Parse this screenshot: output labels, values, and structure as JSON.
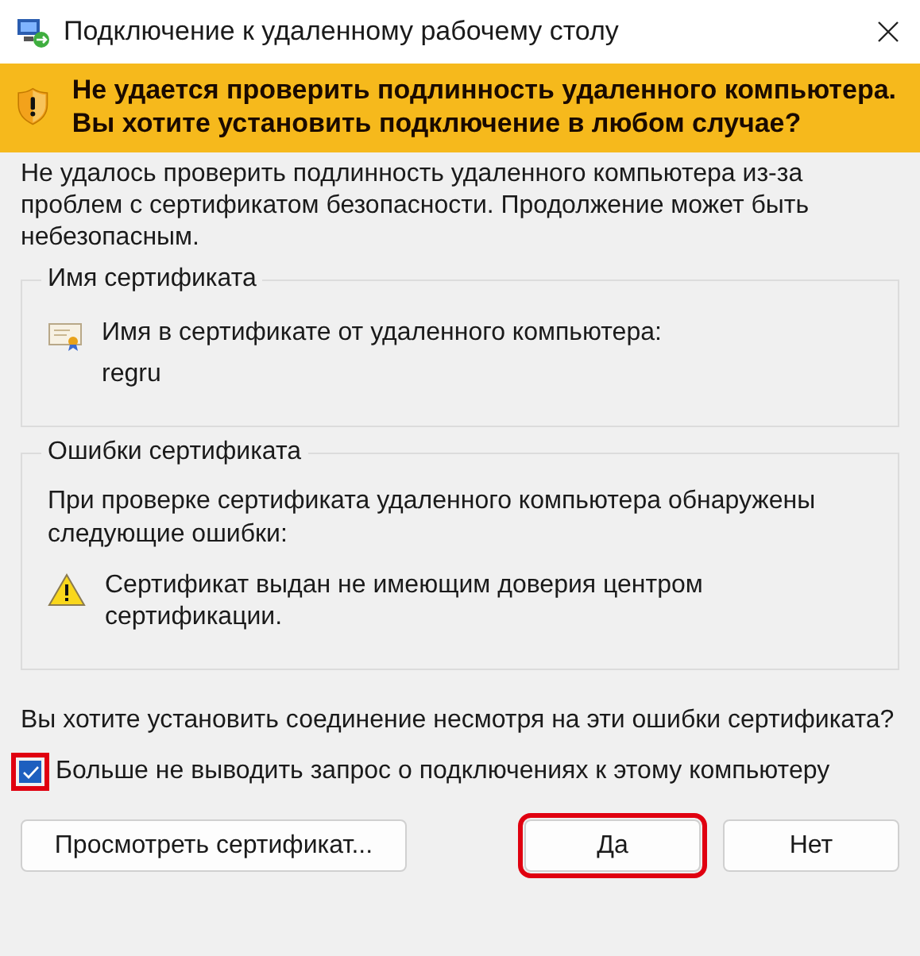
{
  "window": {
    "title": "Подключение к удаленному рабочему столу"
  },
  "banner": {
    "text": "Не удается проверить подлинность удаленного компьютера. Вы хотите установить подключение в любом случае?"
  },
  "intro": "Не удалось проверить подлинность удаленного компьютера из-за проблем с сертификатом безопасности. Продолжение может быть небезопасным.",
  "groups": [
    {
      "title": "Имя сертификата",
      "kind": "name",
      "lines": [
        "Имя в сертификате от удаленного компьютера:",
        "regru"
      ]
    },
    {
      "title": "Ошибки сертификата",
      "kind": "errors",
      "lines": [
        "При проверке сертификата удаленного компьютера обнаружены следующие ошибки:",
        "Сертификат выдан не имеющим доверия центром сертификации."
      ]
    }
  ],
  "question": "Вы хотите установить соединение несмотря на эти ошибки сертификата?",
  "checkbox": {
    "label": "Больше не выводить запрос о подключениях к этому компьютеру",
    "checked": true,
    "highlighted": true
  },
  "buttons": [
    {
      "label": "Просмотреть сертификат...",
      "highlighted": false
    },
    {
      "label": "Да",
      "highlighted": true
    },
    {
      "label": "Нет",
      "highlighted": false
    }
  ]
}
